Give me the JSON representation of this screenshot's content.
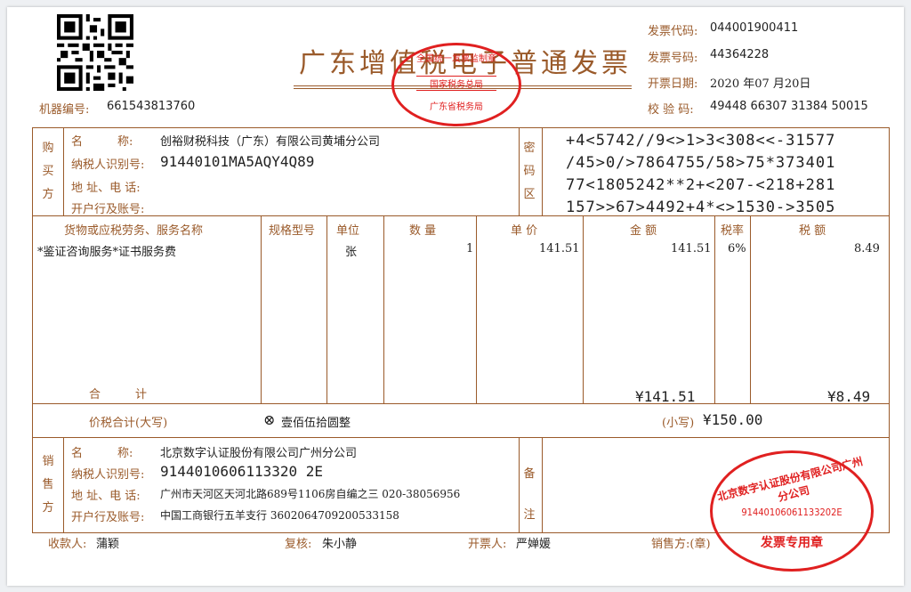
{
  "invoice": {
    "title": "广东增值税电子普通发票",
    "machine_no_label": "机器编号:",
    "machine_no": "661543813760",
    "code_label": "发票代码:",
    "code": "044001900411",
    "number_label": "发票号码:",
    "number": "44364228",
    "date_label": "开票日期:",
    "date": "2020 年07 月20日",
    "check_label": "校 验 码:",
    "check_code": "49448 66307 31384 50015"
  },
  "buyer": {
    "side_label": [
      "购",
      "买",
      "方"
    ],
    "name_label": "名　　　称:",
    "name": "创裕财税科技（广东）有限公司黄埔分公司",
    "tax_id_label": "纳税人识别号:",
    "tax_id": "91440101MA5AQY4Q89",
    "address_label": "地 址、电 话:",
    "address": "",
    "bank_label": "开户行及账号:",
    "bank": ""
  },
  "cipher": {
    "side_label": [
      "密",
      "码",
      "区"
    ],
    "lines": [
      "+4<5742//9<>1>3<308<<-31577",
      "/45>0/>7864755/58>75*373401",
      "77<1805242**2+<207-<218+281",
      "157>>67>4492+4*<>1530->3505"
    ]
  },
  "items": {
    "headers": [
      "货物或应税劳务、服务名称",
      "规格型号",
      "单位",
      "数 量",
      "单 价",
      "金 额",
      "税率",
      "税 额"
    ],
    "rows": [
      {
        "name": "*鉴证咨询服务*证书服务费",
        "spec": "",
        "unit": "张",
        "qty": "1",
        "price": "141.51",
        "amount": "141.51",
        "rate": "6%",
        "tax": "8.49"
      }
    ],
    "total_label": "合　　　计",
    "total_amount": "¥141.51",
    "total_tax": "¥8.49"
  },
  "grand_total": {
    "label": "价税合计(大写)",
    "icon": "x-circle-icon",
    "words": "壹佰伍拾圆整",
    "small_label": "(小写)",
    "figure": "¥150.00"
  },
  "seller": {
    "side_label": [
      "销",
      "售",
      "方"
    ],
    "name_label": "名　　　称:",
    "name": "北京数字认证股份有限公司广州分公司",
    "tax_id_label": "纳税人识别号:",
    "tax_id": "9144010606113320 2E",
    "address_label": "地 址、电 话:",
    "address": "广州市天河区天河北路689号1106房自编之三 020-38056956",
    "bank_label": "开户行及账号:",
    "bank": "中国工商银行五羊支行 3602064709200533158"
  },
  "remark": {
    "side_label": [
      "备",
      "注"
    ]
  },
  "footer": {
    "payee_label": "收款人:",
    "payee": "蒲颖",
    "reviewer_label": "复核:",
    "reviewer": "朱小静",
    "issuer_label": "开票人:",
    "issuer": "严婵媛",
    "seller_label": "销售方:(章)"
  },
  "stamps": {
    "tax_bureau_top": "全国统一发票监制章",
    "tax_bureau_mid": "国家税务总局",
    "tax_bureau_bottom": "广东省税务局",
    "company_name": "北京数字认证股份有限公司广州分公司",
    "company_tax_id": "91440106061133202E",
    "company_purpose": "发票专用章"
  },
  "colors": {
    "frame": "#9a5a2a",
    "stamp": "#e02020",
    "text": "#222222"
  }
}
